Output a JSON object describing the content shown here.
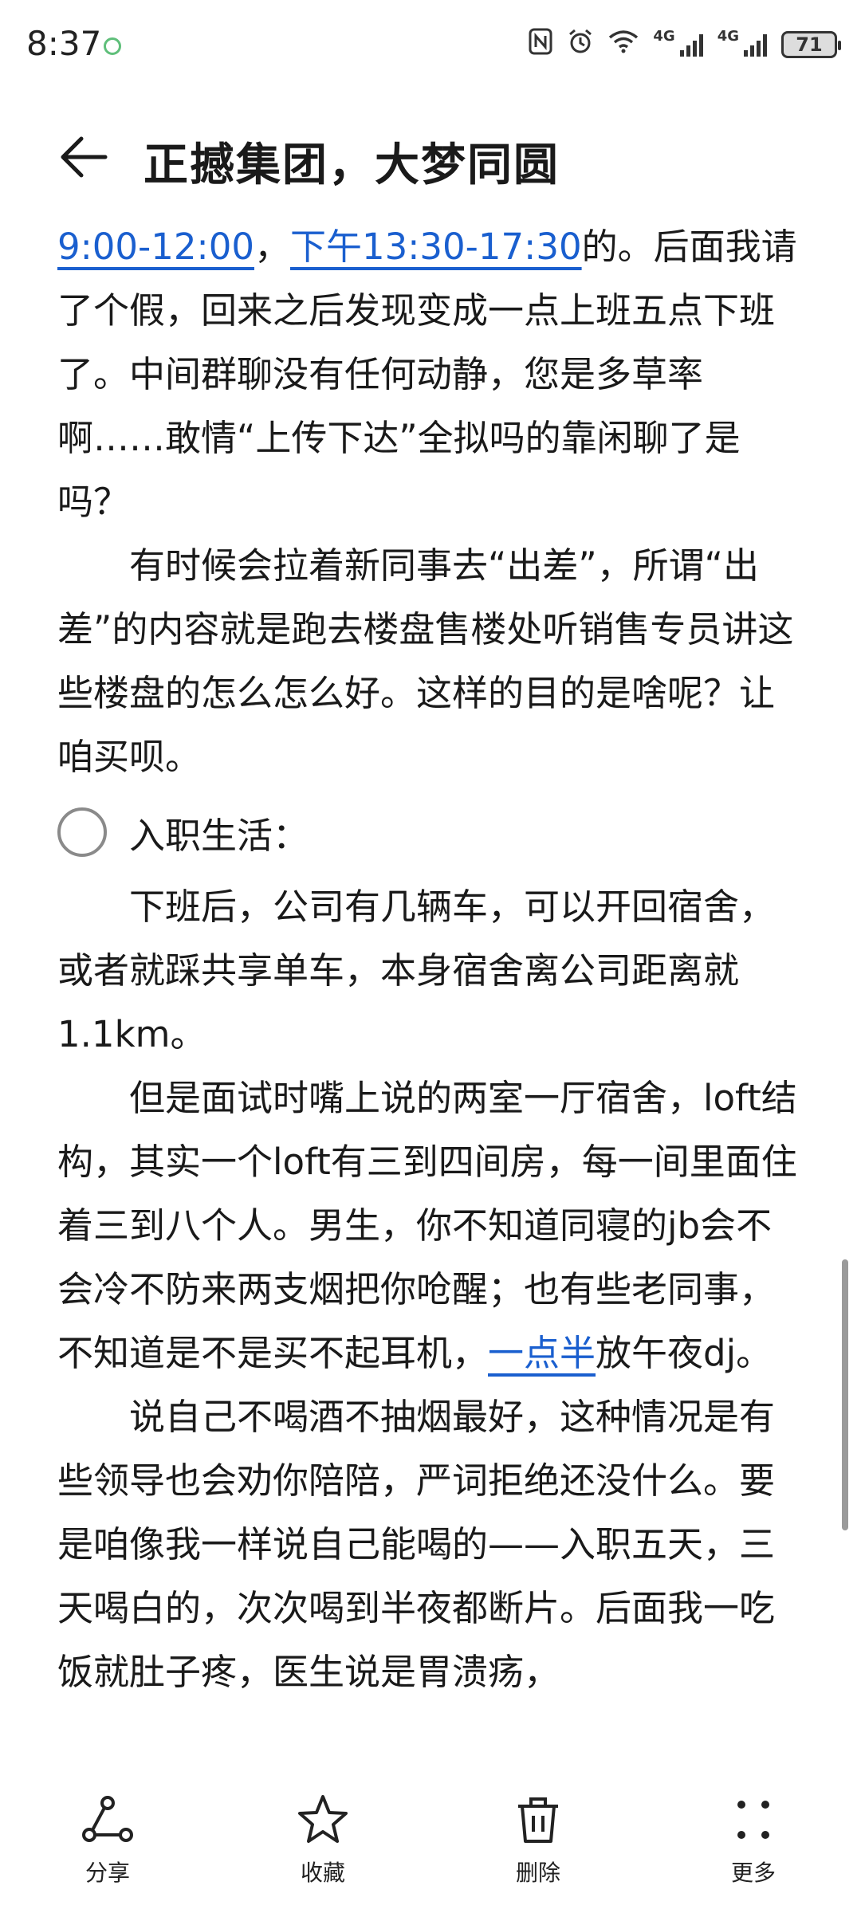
{
  "status_bar": {
    "time": "8:37",
    "net1": "4G",
    "net2": "4G",
    "battery": "71"
  },
  "header": {
    "title": "正撼集团，大梦同圆"
  },
  "content": {
    "p1_link1": "9:00-12:00",
    "p1_sep": "，",
    "p1_link2": "下午13:30-17:30",
    "p1_rest": "的。后面我请了个假，回来之后发现变成一点上班五点下班了。中间群聊没有任何动静，您是多草率啊……敢情“上传下达”全拟吗的靠闲聊了是吗？",
    "p2": "有时候会拉着新同事去“出差”，所谓“出差”的内容就是跑去楼盘售楼处听销售专员讲这些楼盘的怎么怎么好。这样的目的是啥呢？让咱买呗。",
    "checkbox_label": "入职生活：",
    "p3": "下班后，公司有几辆车，可以开回宿舍，或者就踩共享单车，本身宿舍离公司距离就1.1km。",
    "p4_text": "但是面试时嘴上说的两室一厅宿舍，loft结构，其实一个loft有三到四间房，每一间里面住着三到八个人。男生，你不知道同寝的jb会不会冷不防来两支烟把你呛醒；也有些老同事，不知道是不是买不起耳机，",
    "p4_link": "一点半",
    "p4_end": "放午夜dj。",
    "p5": "说自己不喝酒不抽烟最好，这种情况是有些领导也会劝你陪陪，严词拒绝还没什么。要是咱像我一样说自己能喝的——入职五天，三天喝白的，次次喝到半夜都断片。后面我一吃饭就肚子疼，医生说是胃溃疡，"
  },
  "bottom_bar": {
    "share": "分享",
    "favorite": "收藏",
    "delete": "删除",
    "more": "更多"
  },
  "colors": {
    "link": "#1a5fcf",
    "text": "#1a1a1a",
    "background": "#ffffff"
  }
}
